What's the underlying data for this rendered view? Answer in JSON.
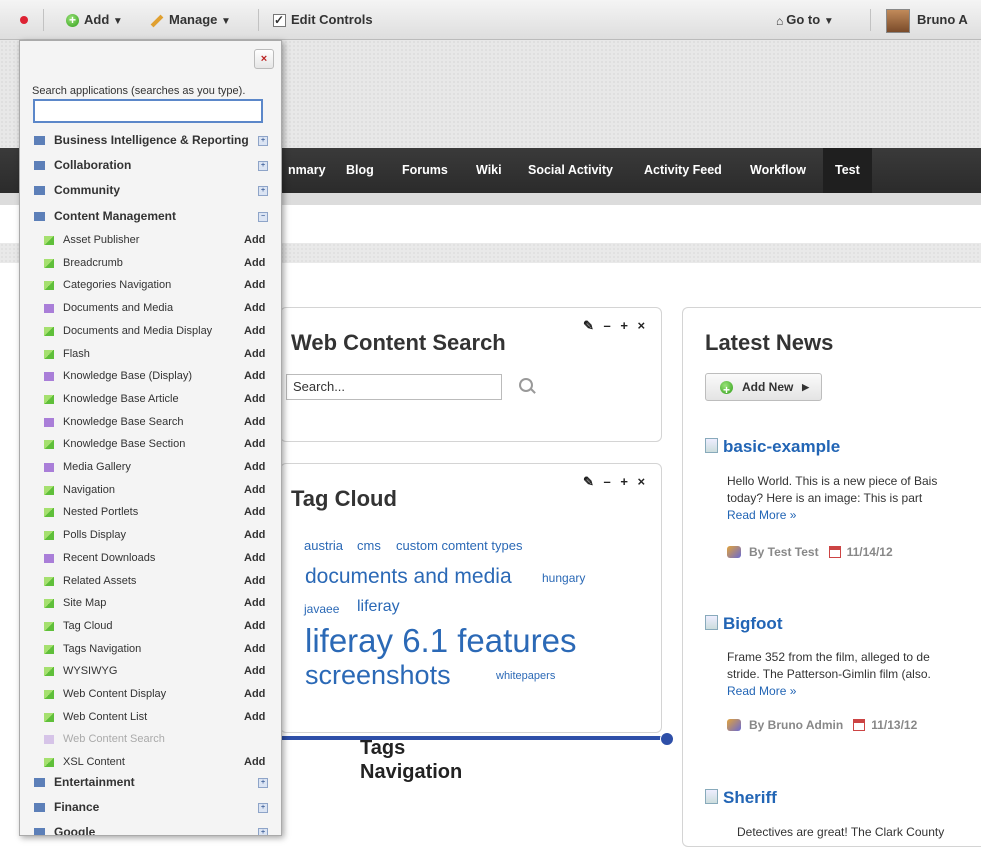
{
  "topbar": {
    "add_label": "Add",
    "manage_label": "Manage",
    "edit_controls_label": "Edit Controls",
    "goto_label": "Go to",
    "user_name": "Bruno A"
  },
  "nav": {
    "items": [
      "nmary",
      "Blog",
      "Forums",
      "Wiki",
      "Social Activity",
      "Activity Feed",
      "Workflow",
      "Test"
    ],
    "active": "Test"
  },
  "web_content_search": {
    "title": "Web Content Search",
    "search_value": "Search...",
    "controls": "✎ – + ×"
  },
  "tag_cloud": {
    "title": "Tag Cloud",
    "controls": "✎ – + ×",
    "tags": [
      "austria",
      "cms",
      "custom comtent types",
      "documents and media",
      "hungary",
      "javaee",
      "liferay",
      "liferay 6.1 features",
      "screenshots",
      "whitepapers"
    ]
  },
  "tags_navigation": {
    "title": "Tags Navigation"
  },
  "latest_news": {
    "title": "Latest News",
    "add_new_label": "Add New",
    "articles": [
      {
        "title": "basic-example",
        "line1": "Hello World. This is a new piece of Bais",
        "line2": "today?  Here is an image:   This is part",
        "read_more": "Read More »",
        "author": "By Test Test",
        "date": "11/14/12"
      },
      {
        "title": "Bigfoot",
        "line1": "     Frame 352 from the film, alleged to de",
        "line2": "stride. The  Patterson-Gimlin film  (also.",
        "read_more": "Read More »",
        "author": "By Bruno Admin",
        "date": "11/13/12"
      },
      {
        "title": "Sheriff",
        "line1": "Detectives are great! The Clark County"
      }
    ]
  },
  "add_panel": {
    "close_label": "×",
    "search_label": "Search applications (searches as you type).",
    "search_value": "",
    "categories_top": [
      {
        "label": "Business Intelligence & Reporting",
        "toggle": "+"
      },
      {
        "label": "Collaboration",
        "toggle": "+"
      },
      {
        "label": "Community",
        "toggle": "+"
      },
      {
        "label": "Content Management",
        "toggle": "−"
      }
    ],
    "items": [
      {
        "name": "Asset Publisher",
        "add": "Add",
        "icon": "green"
      },
      {
        "name": "Breadcrumb",
        "add": "Add",
        "icon": "green"
      },
      {
        "name": "Categories Navigation",
        "add": "Add",
        "icon": "green"
      },
      {
        "name": "Documents and Media",
        "add": "Add",
        "icon": "purple"
      },
      {
        "name": "Documents and Media Display",
        "add": "Add",
        "icon": "green"
      },
      {
        "name": "Flash",
        "add": "Add",
        "icon": "green"
      },
      {
        "name": "Knowledge Base (Display)",
        "add": "Add",
        "icon": "purple"
      },
      {
        "name": "Knowledge Base Article",
        "add": "Add",
        "icon": "green"
      },
      {
        "name": "Knowledge Base Search",
        "add": "Add",
        "icon": "purple"
      },
      {
        "name": "Knowledge Base Section",
        "add": "Add",
        "icon": "green"
      },
      {
        "name": "Media Gallery",
        "add": "Add",
        "icon": "purple"
      },
      {
        "name": "Navigation",
        "add": "Add",
        "icon": "green"
      },
      {
        "name": "Nested Portlets",
        "add": "Add",
        "icon": "green"
      },
      {
        "name": "Polls Display",
        "add": "Add",
        "icon": "green"
      },
      {
        "name": "Recent Downloads",
        "add": "Add",
        "icon": "purple"
      },
      {
        "name": "Related Assets",
        "add": "Add",
        "icon": "green"
      },
      {
        "name": "Site Map",
        "add": "Add",
        "icon": "green"
      },
      {
        "name": "Tag Cloud",
        "add": "Add",
        "icon": "green"
      },
      {
        "name": "Tags Navigation",
        "add": "Add",
        "icon": "green"
      },
      {
        "name": "WYSIWYG",
        "add": "Add",
        "icon": "green"
      },
      {
        "name": "Web Content Display",
        "add": "Add",
        "icon": "green"
      },
      {
        "name": "Web Content List",
        "add": "Add",
        "icon": "green"
      },
      {
        "name": "Web Content Search",
        "add": "",
        "icon": "purple"
      },
      {
        "name": "XSL Content",
        "add": "Add",
        "icon": "green"
      }
    ],
    "categories_bottom": [
      {
        "label": "Entertainment",
        "toggle": "+"
      },
      {
        "label": "Finance",
        "toggle": "+"
      },
      {
        "label": "Google",
        "toggle": "+"
      }
    ]
  },
  "colors": {
    "link": "#2265b5",
    "nav_bg": "#2b2b2b",
    "category_icon": "#5c7fb8"
  }
}
